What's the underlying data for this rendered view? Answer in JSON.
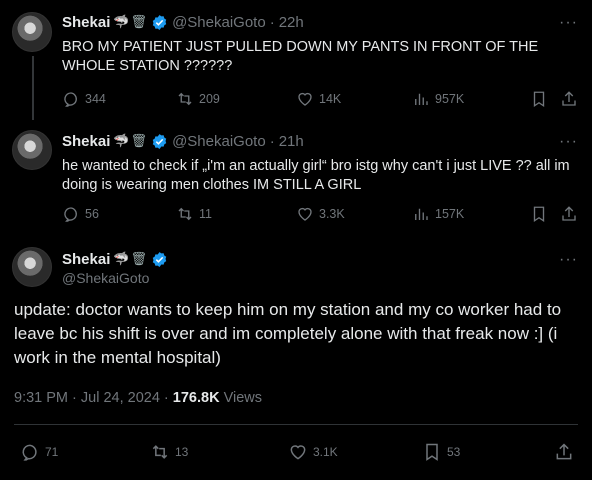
{
  "tweets": [
    {
      "name": "Shekai",
      "emojis": "🦈🗑",
      "handle": "@ShekaiGoto",
      "time": "22h",
      "text": "BRO MY PATIENT JUST PULLED DOWN MY PANTS IN FRONT OF THE WHOLE STATION ??????",
      "replies": "344",
      "retweets": "209",
      "likes": "14K",
      "views": "957K"
    },
    {
      "name": "Shekai",
      "emojis": "🦈🗑",
      "handle": "@ShekaiGoto",
      "time": "21h",
      "text": "he wanted to check if „i'm an actually girl“ bro istg why can't i just LIVE ?? all im doing is wearing men clothes IM STILL A GIRL",
      "replies": "56",
      "retweets": "11",
      "likes": "3.3K",
      "views": "157K"
    }
  ],
  "main": {
    "name": "Shekai",
    "emojis": "🦈🗑",
    "handle": "@ShekaiGoto",
    "text": "update: doctor wants to keep him on my station and my co worker had to leave bc his shift is over and im completely alone with that freak now :] (i work in the mental hospital)",
    "timestamp": "9:31 PM · Jul 24, 2024 · ",
    "views_count": "176.8K",
    "views_label": " Views",
    "replies": "71",
    "retweets": "13",
    "likes": "3.1K",
    "bookmarks": "53"
  },
  "more_label": "···",
  "dot": "·",
  "colors": {
    "background": "#000000",
    "text": "#e7e9ea",
    "muted": "#71767b",
    "verified": "#1d9bf0"
  }
}
